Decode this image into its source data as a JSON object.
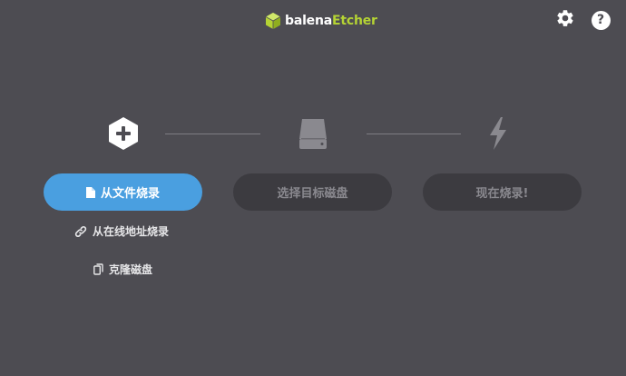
{
  "header": {
    "logo_text_a": "balena",
    "logo_text_b": "Etcher",
    "logo_icon": "cube-icon",
    "settings_icon": "gear-icon",
    "help_label": "?"
  },
  "steps": {
    "source": {
      "icon": "plus-hexagon-icon",
      "button_label": "从文件烧录",
      "links": [
        {
          "label": "从在线地址烧录",
          "icon": "link-icon"
        },
        {
          "label": "克隆磁盘",
          "icon": "copy-icon"
        }
      ]
    },
    "target": {
      "icon": "drive-icon",
      "button_label": "选择目标磁盘"
    },
    "flash": {
      "icon": "lightning-icon",
      "button_label": "现在烧录!"
    }
  },
  "colors": {
    "background": "#4d4c52",
    "primary": "#4a9fe0",
    "disabled_button": "#3c3b40",
    "brand_accent": "#b5d334"
  }
}
